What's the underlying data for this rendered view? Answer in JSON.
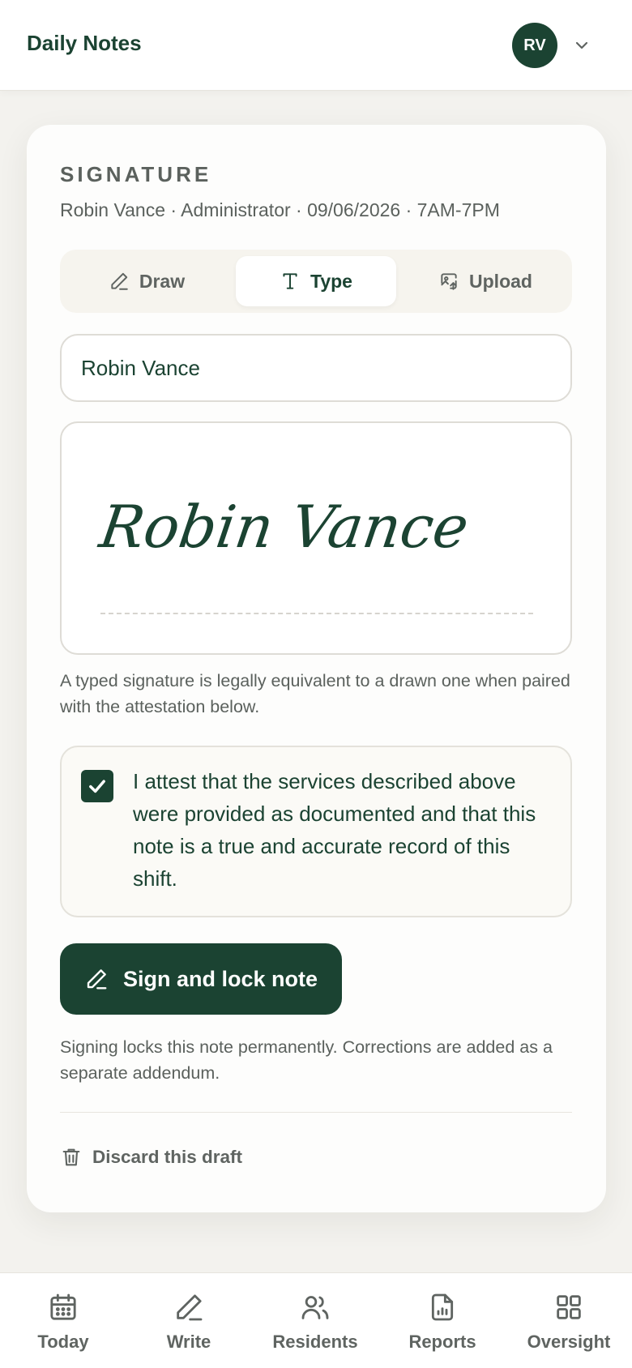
{
  "header": {
    "app_title": "Daily Notes",
    "avatar_initials": "RV"
  },
  "signature": {
    "section_title": "SIGNATURE",
    "meta": "Robin Vance · Administrator · 09/06/2026 · 7AM-7PM",
    "modes": [
      {
        "label": "Draw",
        "icon": "pencil-icon",
        "active": false
      },
      {
        "label": "Type",
        "icon": "text-type-icon",
        "active": true
      },
      {
        "label": "Upload",
        "icon": "image-upload-icon",
        "active": false
      }
    ],
    "typed_name": "Robin Vance",
    "preview_text": "Robin Vance",
    "legal_note": "A typed signature is legally equivalent to a drawn one when paired with the attestation below.",
    "attestation_checked": true,
    "attestation_text": "I attest that the services described above were provided as documented and that this note is a true and accurate record of this shift.",
    "sign_button_label": "Sign and lock note",
    "lock_note": "Signing locks this note permanently. Corrections are added as a separate addendum.",
    "discard_label": "Discard this draft"
  },
  "bottom_nav": {
    "items": [
      {
        "label": "Today",
        "icon": "calendar-icon"
      },
      {
        "label": "Write",
        "icon": "pen-icon"
      },
      {
        "label": "Residents",
        "icon": "users-icon"
      },
      {
        "label": "Reports",
        "icon": "report-icon"
      },
      {
        "label": "Oversight",
        "icon": "grid-icon"
      }
    ]
  },
  "colors": {
    "brand": "#1b4332",
    "muted_text": "#5b615d",
    "page_bg": "#f3f2ee"
  }
}
